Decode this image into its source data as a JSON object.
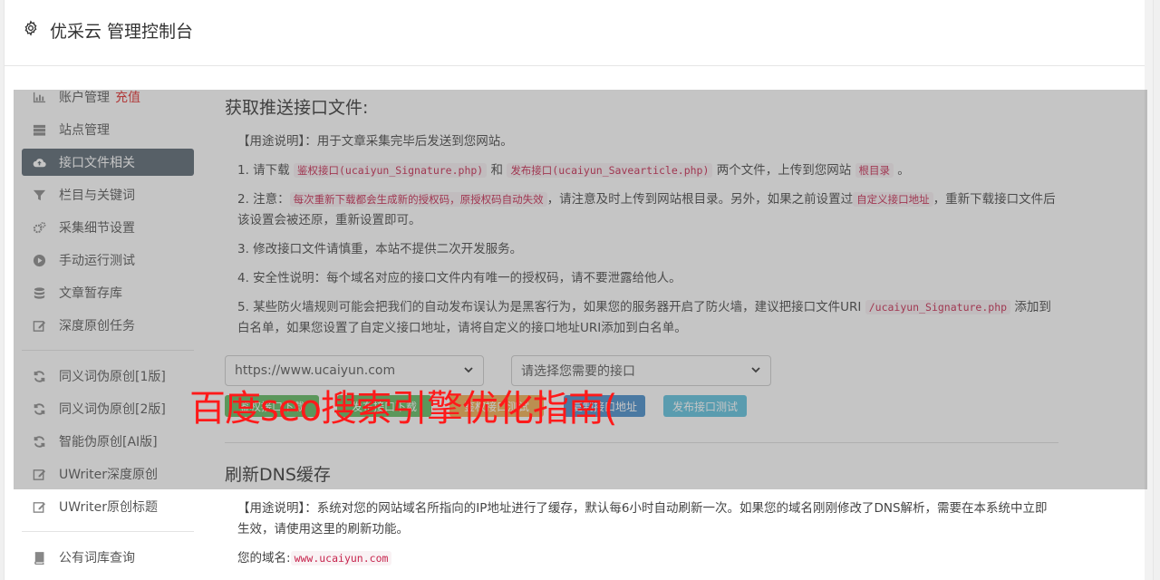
{
  "header": {
    "title": "优采云 管理控制台",
    "icon": "gear-icon"
  },
  "sidebar": {
    "items": [
      {
        "label": "账户管理",
        "badge": "充值",
        "icon": "bar-chart-icon"
      },
      {
        "label": "站点管理",
        "icon": "server-icon"
      },
      {
        "label": "接口文件相关",
        "icon": "cloud-upload-icon",
        "active": true
      },
      {
        "label": "栏目与关键词",
        "icon": "filter-icon"
      },
      {
        "label": "采集细节设置",
        "icon": "cogs-icon"
      },
      {
        "label": "手动运行测试",
        "icon": "play-icon"
      },
      {
        "label": "文章暂存库",
        "icon": "database-icon"
      },
      {
        "label": "深度原创任务",
        "icon": "edit-icon"
      }
    ],
    "items2": [
      {
        "label": "同义词伪原创[1版]",
        "icon": "refresh-icon"
      },
      {
        "label": "同义词伪原创[2版]",
        "icon": "refresh-icon"
      },
      {
        "label": "智能伪原创[AI版]",
        "icon": "refresh-icon"
      },
      {
        "label": "UWriter深度原创",
        "icon": "edit-icon"
      },
      {
        "label": "UWriter原创标题",
        "icon": "edit-icon"
      }
    ],
    "items3": [
      {
        "label": "公有词库查询",
        "icon": "book-icon"
      }
    ]
  },
  "main": {
    "section1": {
      "title": "获取推送接口文件:",
      "usage_tag": "【用途说明】",
      "usage_text": "：用于文章采集完毕后发送到您网站。",
      "l1_a": "1. 请下载 ",
      "l1_code1": "鉴权接口(ucaiyun_Signature.php)",
      "l1_b": " 和 ",
      "l1_code2": "发布接口(ucaiyun_Savearticle.php)",
      "l1_c": " 两个文件，上传到您网站 ",
      "l1_code3": "根目录",
      "l1_d": " 。",
      "l2_a": "2. 注意：",
      "l2_code1": "每次重新下载都会生成新的授权码，原授权码自动失效",
      "l2_b": "，请注意及时上传到网站根目录。另外，如果之前设置过",
      "l2_code2": "自定义接口地址",
      "l2_c": "，重新下载接口文件后该设置会被还原，重新设置即可。",
      "l3": "3. 修改接口文件请慎重，本站不提供二次开发服务。",
      "l4": "4. 安全性说明：每个域名对应的接口文件内有唯一的授权码，请不要泄露给他人。",
      "l5_a": "5. 某些防火墙规则可能会把我们的自动发布误认为是黑客行为，如果您的服务器开启了防火墙，建议把接口文件URI ",
      "l5_code": "/ucaiyun_Signature.php",
      "l5_b": " 添加到白名单，如果您设置了自定义接口地址，请将自定义的接口地址URI添加到白名单。",
      "site_select": "https://www.ucaiyun.com",
      "api_select": "请选择您需要的接口",
      "buttons": [
        "鉴权接口下载",
        "发布接口下载",
        "鉴权接口测试",
        "复制接口地址",
        "发布接口测试"
      ]
    },
    "section2": {
      "title": "刷新DNS缓存",
      "usage_tag": "【用途说明】",
      "usage_text": "：系统对您的网站域名所指向的IP地址进行了缓存，默认每6小时自动刷新一次。如果您的域名刚刚修改了DNS解析，需要在本系统中立即生效，请使用这里的刷新功能。",
      "domain_label": "您的域名:",
      "domain_value": "www.ucaiyun.com"
    }
  },
  "watermark": "百度seo搜索引擎优化指南(",
  "colors": {
    "active_bg": "#57646f",
    "code_red": "#c7254e",
    "watermark": "#ff1a1a"
  }
}
